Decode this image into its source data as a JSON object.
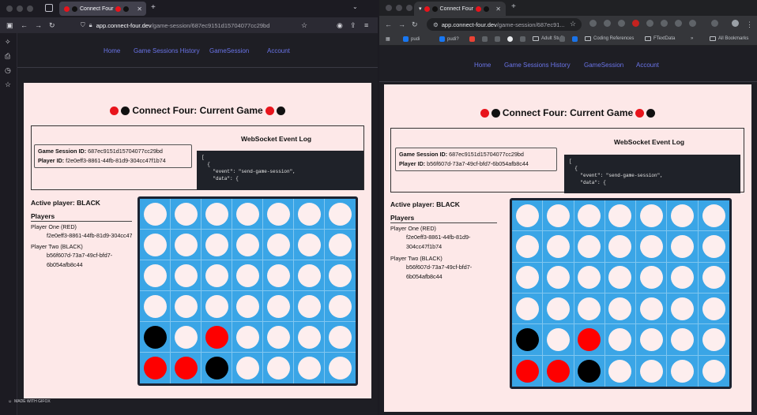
{
  "left_browser": {
    "tab_title": "Connect Four",
    "url_host": "app.connect-four.dev",
    "url_path": "/game-session/687ec9151d15704077cc29bd",
    "made_with": "MADE WITH GIFOX"
  },
  "right_browser": {
    "tab_title": "Connect Four",
    "url_host": "app.connect-four.dev",
    "url_path": "/game-session/687ec91...",
    "bookmarks": [
      "pudi",
      "pudi?",
      "Adult Stuff",
      "Coding References",
      "FTextData",
      "All Bookmarks"
    ]
  },
  "app": {
    "nav": [
      "Home",
      "Game Sessions History",
      "GameSession",
      "Account"
    ],
    "title": "Connect Four: Current Game",
    "session_label": "Game Session ID:",
    "session_id": "687ec9151d15704077cc29bd",
    "player_label": "Player ID:",
    "ws_title": "WebSocket Event Log",
    "ws_log": "[\n  {\n    \"event\": \"send-game-session\",\n    \"data\": {",
    "active_label": "Active player: BLACK",
    "players_heading": "Players",
    "player_one_label": "Player One (RED)",
    "player_one_id": "f2e0eff3-8861-44fb-81d9-304cc47f1b74",
    "player_two_label": "Player Two (BLACK)",
    "player_two_id": "b56f607d-73a7-49cf-bfd7-6b054afb8c44",
    "left_player_id": "f2e0eff3-8861-44fb-81d9-304cc47f1b74",
    "right_player_id": "b56f607d-73a7-49cf-bfd7-6b054afb8c44"
  },
  "board": [
    [
      "",
      "",
      "",
      "",
      "",
      "",
      ""
    ],
    [
      "",
      "",
      "",
      "",
      "",
      "",
      ""
    ],
    [
      "",
      "",
      "",
      "",
      "",
      "",
      ""
    ],
    [
      "",
      "",
      "",
      "",
      "",
      "",
      ""
    ],
    [
      "black",
      "",
      "red",
      "",
      "",
      "",
      ""
    ],
    [
      "red",
      "red",
      "black",
      "",
      "",
      "",
      ""
    ]
  ],
  "colors": {
    "red": "#fe0000",
    "black": "#000000",
    "board": "#3aa5e6",
    "card": "#fde8e8",
    "link": "#6a74e8"
  }
}
